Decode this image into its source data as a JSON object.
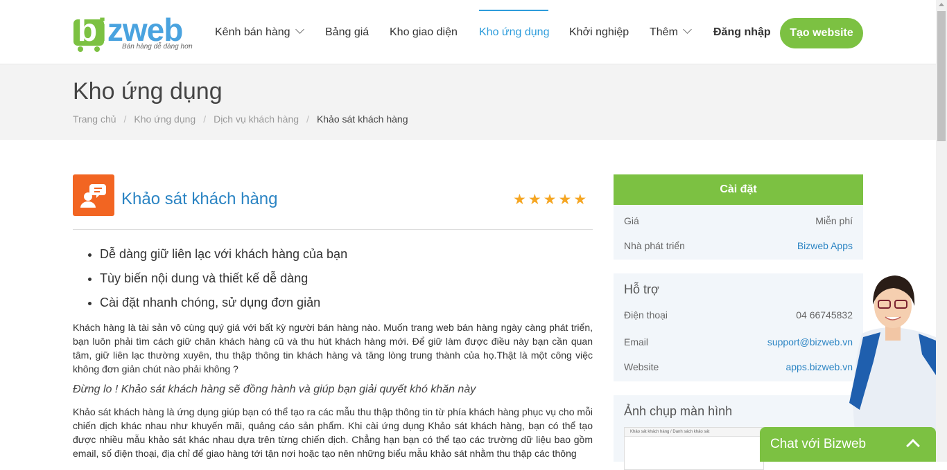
{
  "header": {
    "logo_text": "bizweb",
    "logo_tagline": "Bán hàng dễ dàng hơn",
    "nav": [
      {
        "label": "Kênh bán hàng",
        "dropdown": true
      },
      {
        "label": "Bảng giá"
      },
      {
        "label": "Kho giao diện"
      },
      {
        "label": "Kho ứng dụng",
        "active": true
      },
      {
        "label": "Khởi nghiệp"
      },
      {
        "label": "Thêm",
        "dropdown": true
      }
    ],
    "login_label": "Đăng nhập",
    "create_label": "Tạo website"
  },
  "page": {
    "title": "Kho ứng dụng",
    "breadcrumb": [
      "Trang chủ",
      "Kho ứng dụng",
      "Dịch vụ khách hàng",
      "Khảo sát khách hàng"
    ]
  },
  "app": {
    "name": "Khảo sát khách hàng",
    "rating": 5,
    "bullets": [
      "Dễ dàng giữ liên lạc với khách hàng của bạn",
      "Tùy biến nội dung và thiết kế dễ dàng",
      "Cài đặt nhanh chóng, sử dụng đơn giản"
    ],
    "para1": "Khách hàng là tài sản vô cùng quý giá với bất kỳ người bán hàng nào. Muốn trang web bán hàng ngày càng phát triển, bạn luôn phải tìm cách giữ chân khách hàng cũ và thu hút khách hàng mới. Để giữ làm được điều này bạn cần quan tâm, giữ liên lạc thường xuyên, thu thập thông tin khách hàng và tăng lòng trung thành của họ.Thật là một công việc không đơn giản chút nào phải không ?",
    "italic": "Đừng lo ! Khảo sát khách hàng sẽ đồng hành và giúp bạn giải quyết khó khăn này",
    "para2": "Khảo sát khách hàng là ứng dụng giúp bạn có thể tạo ra các mẫu thu thập thông tin từ phía khách hàng phục vụ cho mỗi chiến dịch khác nhau như khuyến mãi, quảng cáo sản phẩm. Khi cài ứng dụng Khảo sát khách hàng, bạn có thể tạo được nhiều mẫu khảo sát khác nhau dựa trên từng chiến dịch. Chẳng hạn bạn có thể tạo các trường dữ liệu bao gồm email, số điện thoại, địa chỉ để giao hàng tới tận nơi hoặc tạo nên những biểu mẫu khảo sát nhằm thu thập các thông"
  },
  "sidebar": {
    "install_label": "Cài đặt",
    "price_label": "Giá",
    "price_value": "Miễn phí",
    "developer_label": "Nhà phát triển",
    "developer_value": "Bizweb Apps",
    "support_title": "Hỗ trợ",
    "phone_label": "Điện thoại",
    "phone_value": "04 66745832",
    "email_label": "Email",
    "email_value": "support@bizweb.vn",
    "website_label": "Website",
    "website_value": "apps.bizweb.vn",
    "screenshots_title": "Ảnh chụp màn hình",
    "screenshot_caption": "Khảo sát khách hàng / Danh sách khảo sát"
  },
  "chat": {
    "label": "Chat với Bizweb"
  },
  "colors": {
    "brand_green": "#7cc142",
    "brand_blue": "#2b84c3",
    "app_icon": "#f26522",
    "star": "#f5a623"
  }
}
